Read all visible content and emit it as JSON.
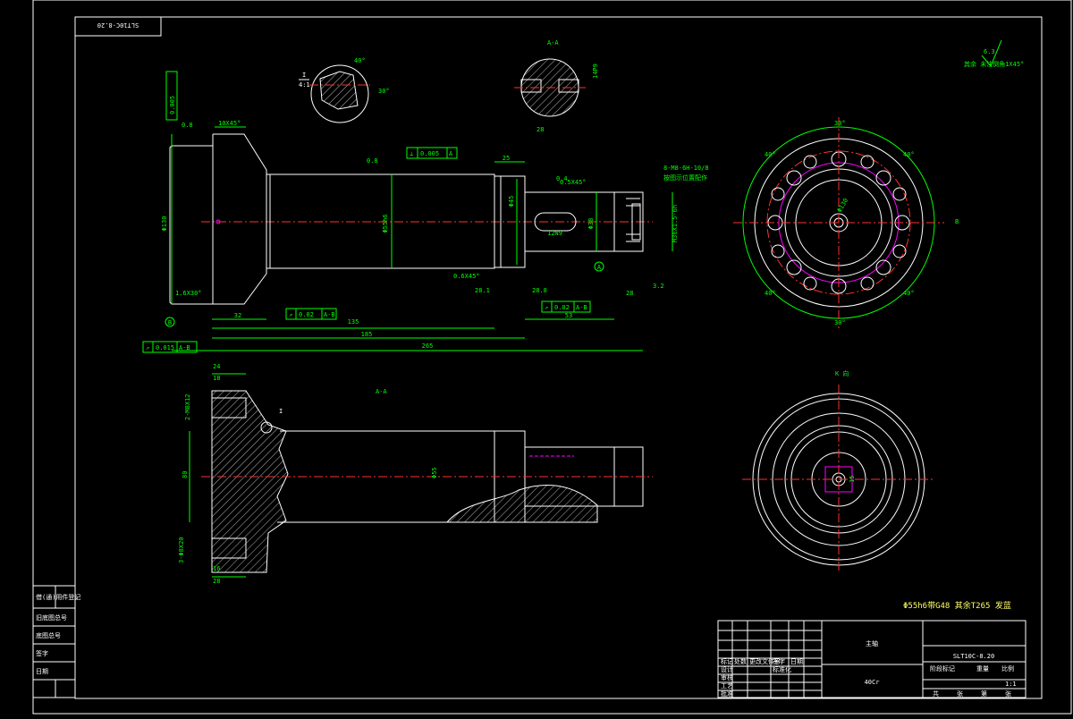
{
  "drawing": {
    "drawing_no_rotated": "SLT10C-8.20",
    "part_name": "主轴",
    "material": "40Cr",
    "drawing_no": "SLT10C-8.20",
    "tech_note": "Φ55h6带G48 其余T265 发蓝",
    "scale": "1:1",
    "note_top_right": "其余 未注倒角1X45°",
    "roughness_top_right": "6.3"
  },
  "views": {
    "section_a_label": "A-A",
    "section_a_label_2": "A-A",
    "detail_label": "I",
    "detail_scale": "4:1",
    "view_k_label": "K 向",
    "view_a_marker": "A",
    "view_b_marker": "B"
  },
  "dims": {
    "d_10x45": "10X45°",
    "d_1_6x30": "1.6X30°",
    "d_0_6x45": "0.6X45°",
    "d_0_5x45": "0.5X45°",
    "d_32": "32",
    "d_25": "25",
    "d_135": "135",
    "d_185": "185",
    "d_265": "265",
    "d_53": "53",
    "d_28": "28",
    "d_24": "24",
    "d_18": "18",
    "d_28_1": "28.1",
    "d_28_8": "28.8",
    "d_80": "80",
    "d_47": "47",
    "d_10": "10",
    "d_16": "16",
    "d_15": "15",
    "d_3_2": "3.2",
    "d_0_8": "0.8",
    "d_0_4": "0.4",
    "d_40": "40°",
    "d_30": "30°",
    "phi_main": "Φ55h6",
    "phi_flange": "Φ130",
    "phi_shaft": "Φ55",
    "phi_end": "Φ45",
    "phi_inner": "Φ38",
    "thread": "M36X1.5-6h",
    "holes": "8-M8-6H-10/8",
    "holes_note": "按图示位置配作",
    "holes_2": "2-M8X12",
    "holes_3": "3-Φ8X20",
    "key": "12N9",
    "key2": "14P9",
    "depth": "35"
  },
  "gdt": {
    "fcf1_sym": "⟂",
    "fcf1_val": "0.005",
    "fcf1_ref": "A",
    "fcf2_sym": "↗",
    "fcf2_val": "0.02",
    "fcf2_ref": "A-B",
    "fcf3_sym": "↗",
    "fcf3_val": "0.015",
    "fcf3_ref": "A-B",
    "fcf4_sym": "↗",
    "fcf4_val": "0.02",
    "fcf4_ref": "A-B",
    "fcf5_sym": "⫽",
    "fcf5_val": "0.005",
    "fcf5_ref": "A"
  },
  "title_block": {
    "rows_left": [
      "标记",
      "处数",
      "更改文件号",
      "签字",
      "日期"
    ],
    "roles": [
      "设计",
      "审核",
      "工艺",
      "批准"
    ],
    "standard_label": "标准化",
    "right_labels": [
      "阶段标记",
      "重量",
      "比例"
    ],
    "right_values": [
      "",
      "",
      "1:1"
    ],
    "sheet_labels": [
      "共",
      "张",
      "第",
      "张"
    ]
  },
  "side_block": {
    "rows": [
      "借(通)用件登记",
      "",
      "旧底图总号",
      "底图总号",
      "签字",
      "日期"
    ]
  }
}
